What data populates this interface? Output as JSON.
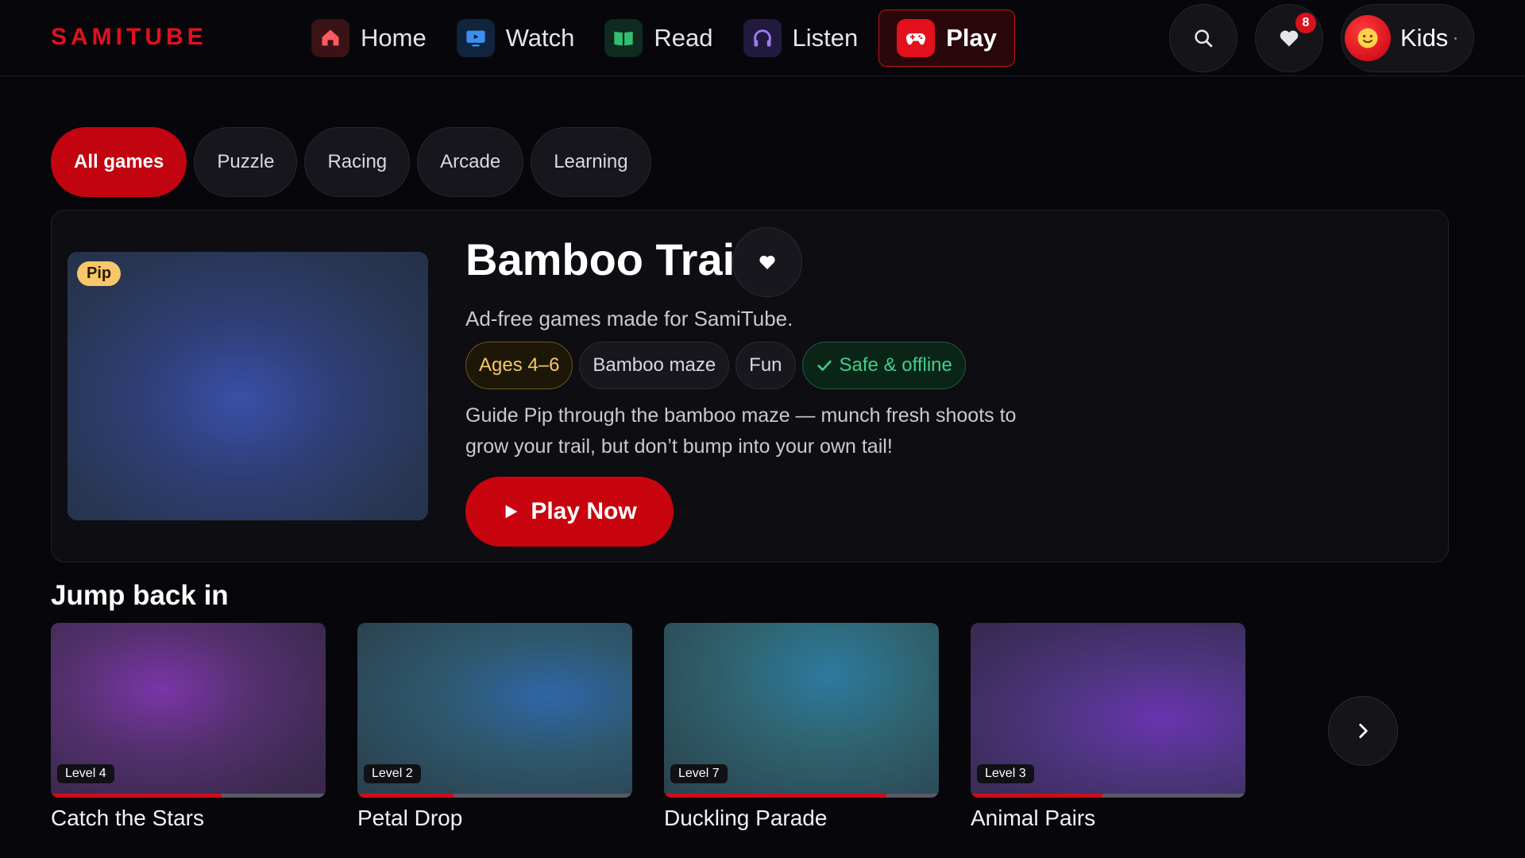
{
  "brand": {
    "logo": "SAMITUBE",
    "color": "#e3101d"
  },
  "nav": {
    "items": [
      {
        "label": "Home",
        "icon": "house-icon",
        "icon_bg": "#3b1316",
        "icon_color": "#ff5a5f",
        "active": false
      },
      {
        "label": "Watch",
        "icon": "tv-icon",
        "icon_bg": "#10243e",
        "icon_color": "#3c8ef0",
        "active": false
      },
      {
        "label": "Read",
        "icon": "book-icon",
        "icon_bg": "#0f2a1e",
        "icon_color": "#2fbf73",
        "active": false
      },
      {
        "label": "Listen",
        "icon": "headphones-icon",
        "icon_bg": "#221a3e",
        "icon_color": "#9c7bf2",
        "active": false
      },
      {
        "label": "Play",
        "icon": "gamepad-icon",
        "icon_bg": "#e3101d",
        "icon_color": "#ffffff",
        "active": true
      }
    ]
  },
  "header": {
    "search_icon": "search-icon",
    "favorites_icon": "heart-icon",
    "favorites_count": "8",
    "profile": {
      "name": "Kids",
      "avatar_icon": "smiley-icon"
    }
  },
  "filters": [
    {
      "label": "All games",
      "active": true
    },
    {
      "label": "Puzzle",
      "active": false
    },
    {
      "label": "Racing",
      "active": false
    },
    {
      "label": "Arcade",
      "active": false
    },
    {
      "label": "Learning",
      "active": false
    }
  ],
  "hero": {
    "character_badge": "Pip",
    "title": "Bamboo Trail",
    "subtitle": "Ad-free games made for SamiTube.",
    "tags": {
      "age": "Ages 4–6",
      "genre": "Bamboo maze",
      "mood": "Fun",
      "safe": "Safe & offline"
    },
    "description": "Guide Pip through the bamboo maze — munch fresh shoots to grow your trail, but don’t bump into your own tail!",
    "cta": "Play Now"
  },
  "jump_back": {
    "title": "Jump back in",
    "cards": [
      {
        "title": "Catch the Stars",
        "level": "Level 4",
        "progress": 0.62
      },
      {
        "title": "Petal Drop",
        "level": "Level 2",
        "progress": 0.35
      },
      {
        "title": "Duckling Parade",
        "level": "Level 7",
        "progress": 0.81
      },
      {
        "title": "Animal Pairs",
        "level": "Level 3",
        "progress": 0.48
      }
    ],
    "next_icon": "chevron-right-icon"
  }
}
